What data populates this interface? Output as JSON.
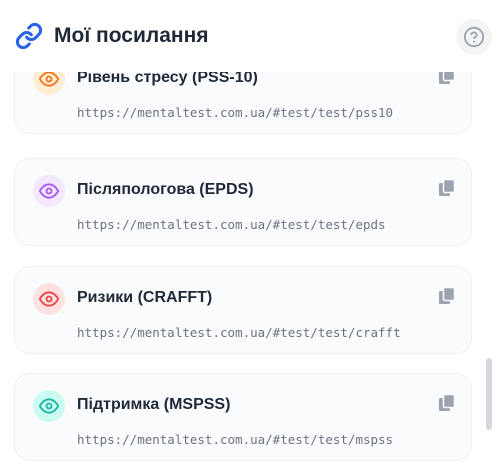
{
  "header": {
    "title": "Мої посилання",
    "icon": "link-icon",
    "help_icon": "help-circle-icon",
    "accent_color": "#2563eb"
  },
  "links": [
    {
      "title": "Рівень стресу (PSS-10)",
      "url": "https://mentaltest.com.ua/#test/test/pss10",
      "icon": "eye-icon",
      "color": "#f97316",
      "badge_bg": "#ffedd5"
    },
    {
      "title": "Післяпологова (EPDS)",
      "url": "https://mentaltest.com.ua/#test/test/epds",
      "icon": "eye-icon",
      "color": "#a855f7",
      "badge_bg": "#f3e8ff"
    },
    {
      "title": "Ризики (CRAFFT)",
      "url": "https://mentaltest.com.ua/#test/test/crafft",
      "icon": "eye-icon",
      "color": "#ef4444",
      "badge_bg": "#fee2e2"
    },
    {
      "title": "Підтримка (MSPSS)",
      "url": "https://mentaltest.com.ua/#test/test/mspss",
      "icon": "eye-icon",
      "color": "#14b8a6",
      "badge_bg": "#ccfbf1"
    }
  ],
  "copy_icon": "copy-icon"
}
